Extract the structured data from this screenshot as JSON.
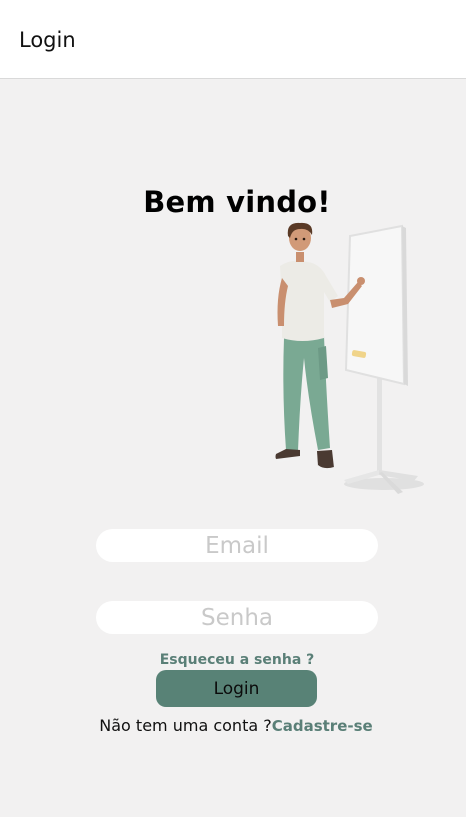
{
  "header": {
    "title": "Login"
  },
  "main": {
    "welcome": "Bem vindo!",
    "illustration": "person-presenting-whiteboard-illustration",
    "email": {
      "placeholder": "Email",
      "value": ""
    },
    "password": {
      "placeholder": "Senha",
      "value": ""
    },
    "forgot_link": "Esqueceu a senha ?",
    "login_button": "Login",
    "signup_prompt": "Não tem uma conta ?",
    "signup_link": "Cadastre-se"
  },
  "colors": {
    "background": "#f2f1f1",
    "accent": "#588276",
    "link": "#5a7f77"
  }
}
